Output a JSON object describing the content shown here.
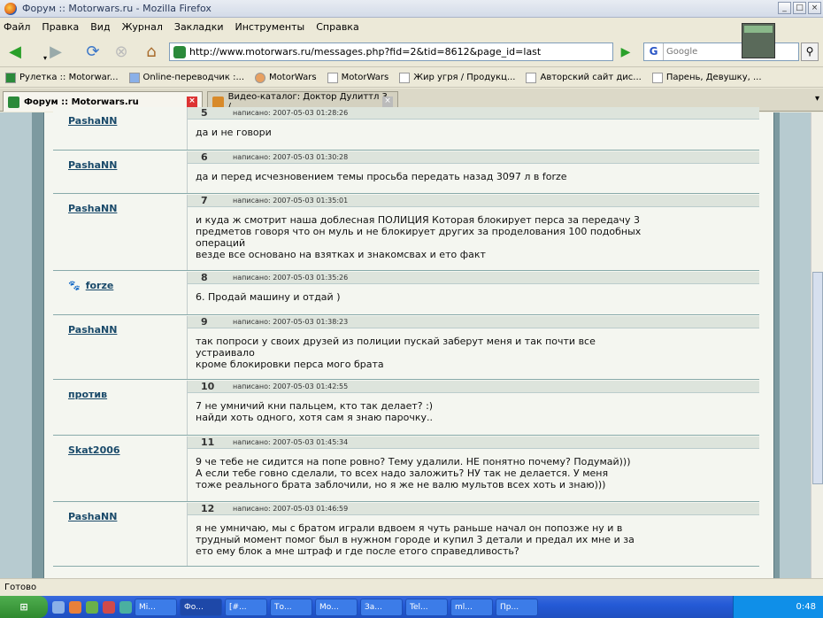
{
  "window": {
    "title": "Форум :: Motorwars.ru - Mozilla Firefox"
  },
  "menu": [
    "Файл",
    "Правка",
    "Вид",
    "Журнал",
    "Закладки",
    "Инструменты",
    "Справка"
  ],
  "nav": {
    "url": "http://www.motorwars.ru/messages.php?fid=2&tid=8612&page_id=last",
    "search_engine": "G",
    "search_placeholder": "Google"
  },
  "bookmarks": [
    "Рулетка :: Motorwar...",
    "Online-переводчик :...",
    "MotorWars",
    "MotorWars",
    "Жир угря / Продукц...",
    "Авторский сайт дис...",
    "Парень, Девушку, ..."
  ],
  "tabs": [
    {
      "label": "Форум :: Motorwars.ru",
      "active": true
    },
    {
      "label": "Видео-каталог: Доктор Дулиттл 3 /...",
      "active": false
    }
  ],
  "posts": [
    {
      "num": "5",
      "author": "PashaNN",
      "date": "написано: 2007-05-03 01:28:26",
      "lines": [
        "да и не говори"
      ]
    },
    {
      "num": "6",
      "author": "PashaNN",
      "date": "написано: 2007-05-03 01:30:28",
      "lines": [
        "да и перед исчезновением темы просьба передать назад 3097 л в forze"
      ]
    },
    {
      "num": "7",
      "author": "PashaNN",
      "date": "написано: 2007-05-03 01:35:01",
      "lines": [
        "и куда ж смотрит наша доблесная ПОЛИЦИЯ Которая блокирует перса за передачу 3",
        "предметов говоря что он муль и не блокирует других за проделования 100 подобных",
        "операций",
        "везде все основано на взятках и знакомсвах и ето факт"
      ]
    },
    {
      "num": "8",
      "author": "forze",
      "date": "написано: 2007-05-03 01:35:26",
      "lines": [
        "6. Продай машину и отдай )"
      ]
    },
    {
      "num": "9",
      "author": "PashaNN",
      "date": "написано: 2007-05-03 01:38:23",
      "lines": [
        "так попроси у своих друзей из полиции пускай заберут меня и так почти все",
        "устраивало",
        "кроме блокировки перса мого брата"
      ]
    },
    {
      "num": "10",
      "author": "против",
      "date": "написано: 2007-05-03 01:42:55",
      "lines": [
        "7 не умничий кни пальцем, кто так делает? :)",
        "найди хоть одного, хотя сам я знаю парочку.."
      ]
    },
    {
      "num": "11",
      "author": "Skat2006",
      "date": "написано: 2007-05-03 01:45:34",
      "lines": [
        "9 че тебе не сидится на попе ровно? Тему удалили. НЕ понятно почему? Подумай)))",
        "А если тебе говно сделали, то всех надо заложить? НУ так не делается. У меня",
        "тоже реального брата заблочили, но я же не валю мультов всех хоть и знаю)))"
      ]
    },
    {
      "num": "12",
      "author": "PashaNN",
      "date": "написано: 2007-05-03 01:46:59",
      "lines": [
        "я не умничаю, мы с братом играли вдвоем я чуть раньше начал он попозже ну и в",
        "трудный момент помог был в нужном городе и купил 3 детали и предал их мне и за",
        "ето ему блок а мне штраф и где после етого справедливость?"
      ]
    }
  ],
  "status": "Готово",
  "taskbar": {
    "buttons": [
      "Mi...",
      "Фо...",
      "[#...",
      "То...",
      "Мо...",
      "За...",
      "Tel...",
      "ml...",
      "Пр..."
    ],
    "clock": "0:48"
  }
}
